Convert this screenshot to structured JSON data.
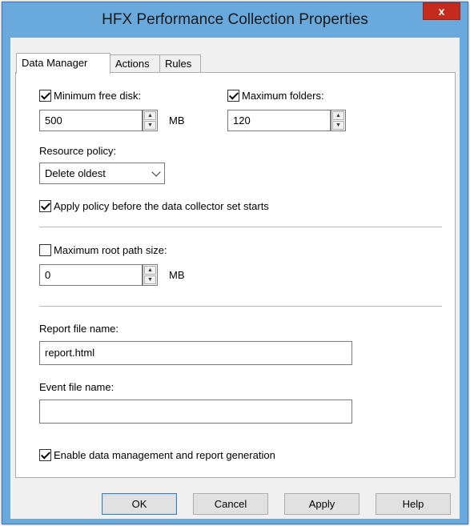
{
  "window": {
    "title": "HFX Performance Collection Properties",
    "close_glyph": "x"
  },
  "tabs": [
    {
      "label": "Data Manager",
      "active": true
    },
    {
      "label": "Actions",
      "active": false
    },
    {
      "label": "Rules",
      "active": false
    }
  ],
  "data_manager": {
    "min_free_disk": {
      "label": "Minimum free disk:",
      "checked": true,
      "value": "500",
      "unit": "MB"
    },
    "max_folders": {
      "label": "Maximum folders:",
      "checked": true,
      "value": "120"
    },
    "resource_policy": {
      "label": "Resource policy:",
      "value": "Delete oldest"
    },
    "apply_policy": {
      "label": "Apply policy before the data collector set starts",
      "checked": true
    },
    "max_root_path": {
      "label": "Maximum root path size:",
      "checked": false,
      "value": "0",
      "unit": "MB"
    },
    "report_file": {
      "label": "Report file name:",
      "value": "report.html"
    },
    "event_file": {
      "label": "Event file name:",
      "value": ""
    },
    "enable_data_mgmt": {
      "label": "Enable data management and report generation",
      "checked": true
    }
  },
  "buttons": {
    "ok": "OK",
    "cancel": "Cancel",
    "apply": "Apply",
    "help": "Help"
  },
  "colors": {
    "title_bar": "#6aa9dc",
    "close_button": "#c42b1c"
  }
}
